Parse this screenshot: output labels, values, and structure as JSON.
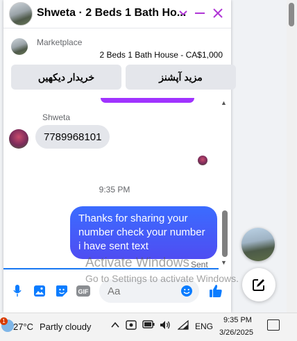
{
  "chat": {
    "title": "Shweta · 2 Beds 1 Bath Ho...",
    "listing_label": "Marketplace",
    "listing_title": "2 Beds 1 Bath House - CA$1,000",
    "action_left": "خریدار دیکھیں",
    "action_right": "مزید آپشنز",
    "sender_name": "Shweta",
    "incoming_message": "7789968101",
    "timestamp": "9:35 PM",
    "outgoing_message": "Thanks for sharing your number check your number i have sent text",
    "sent_status": "Sent",
    "composer_placeholder": "Aa",
    "accent_color": "#b036d6",
    "messenger_blue": "#0a7cff"
  },
  "watermark": {
    "line1": "Activate Windows",
    "line2": "Go to Settings to activate Windows."
  },
  "taskbar": {
    "weather_badge": "1",
    "temperature": "27°C",
    "condition": "Partly cloudy",
    "language": "ENG",
    "time": "9:35 PM",
    "date": "3/26/2025"
  }
}
